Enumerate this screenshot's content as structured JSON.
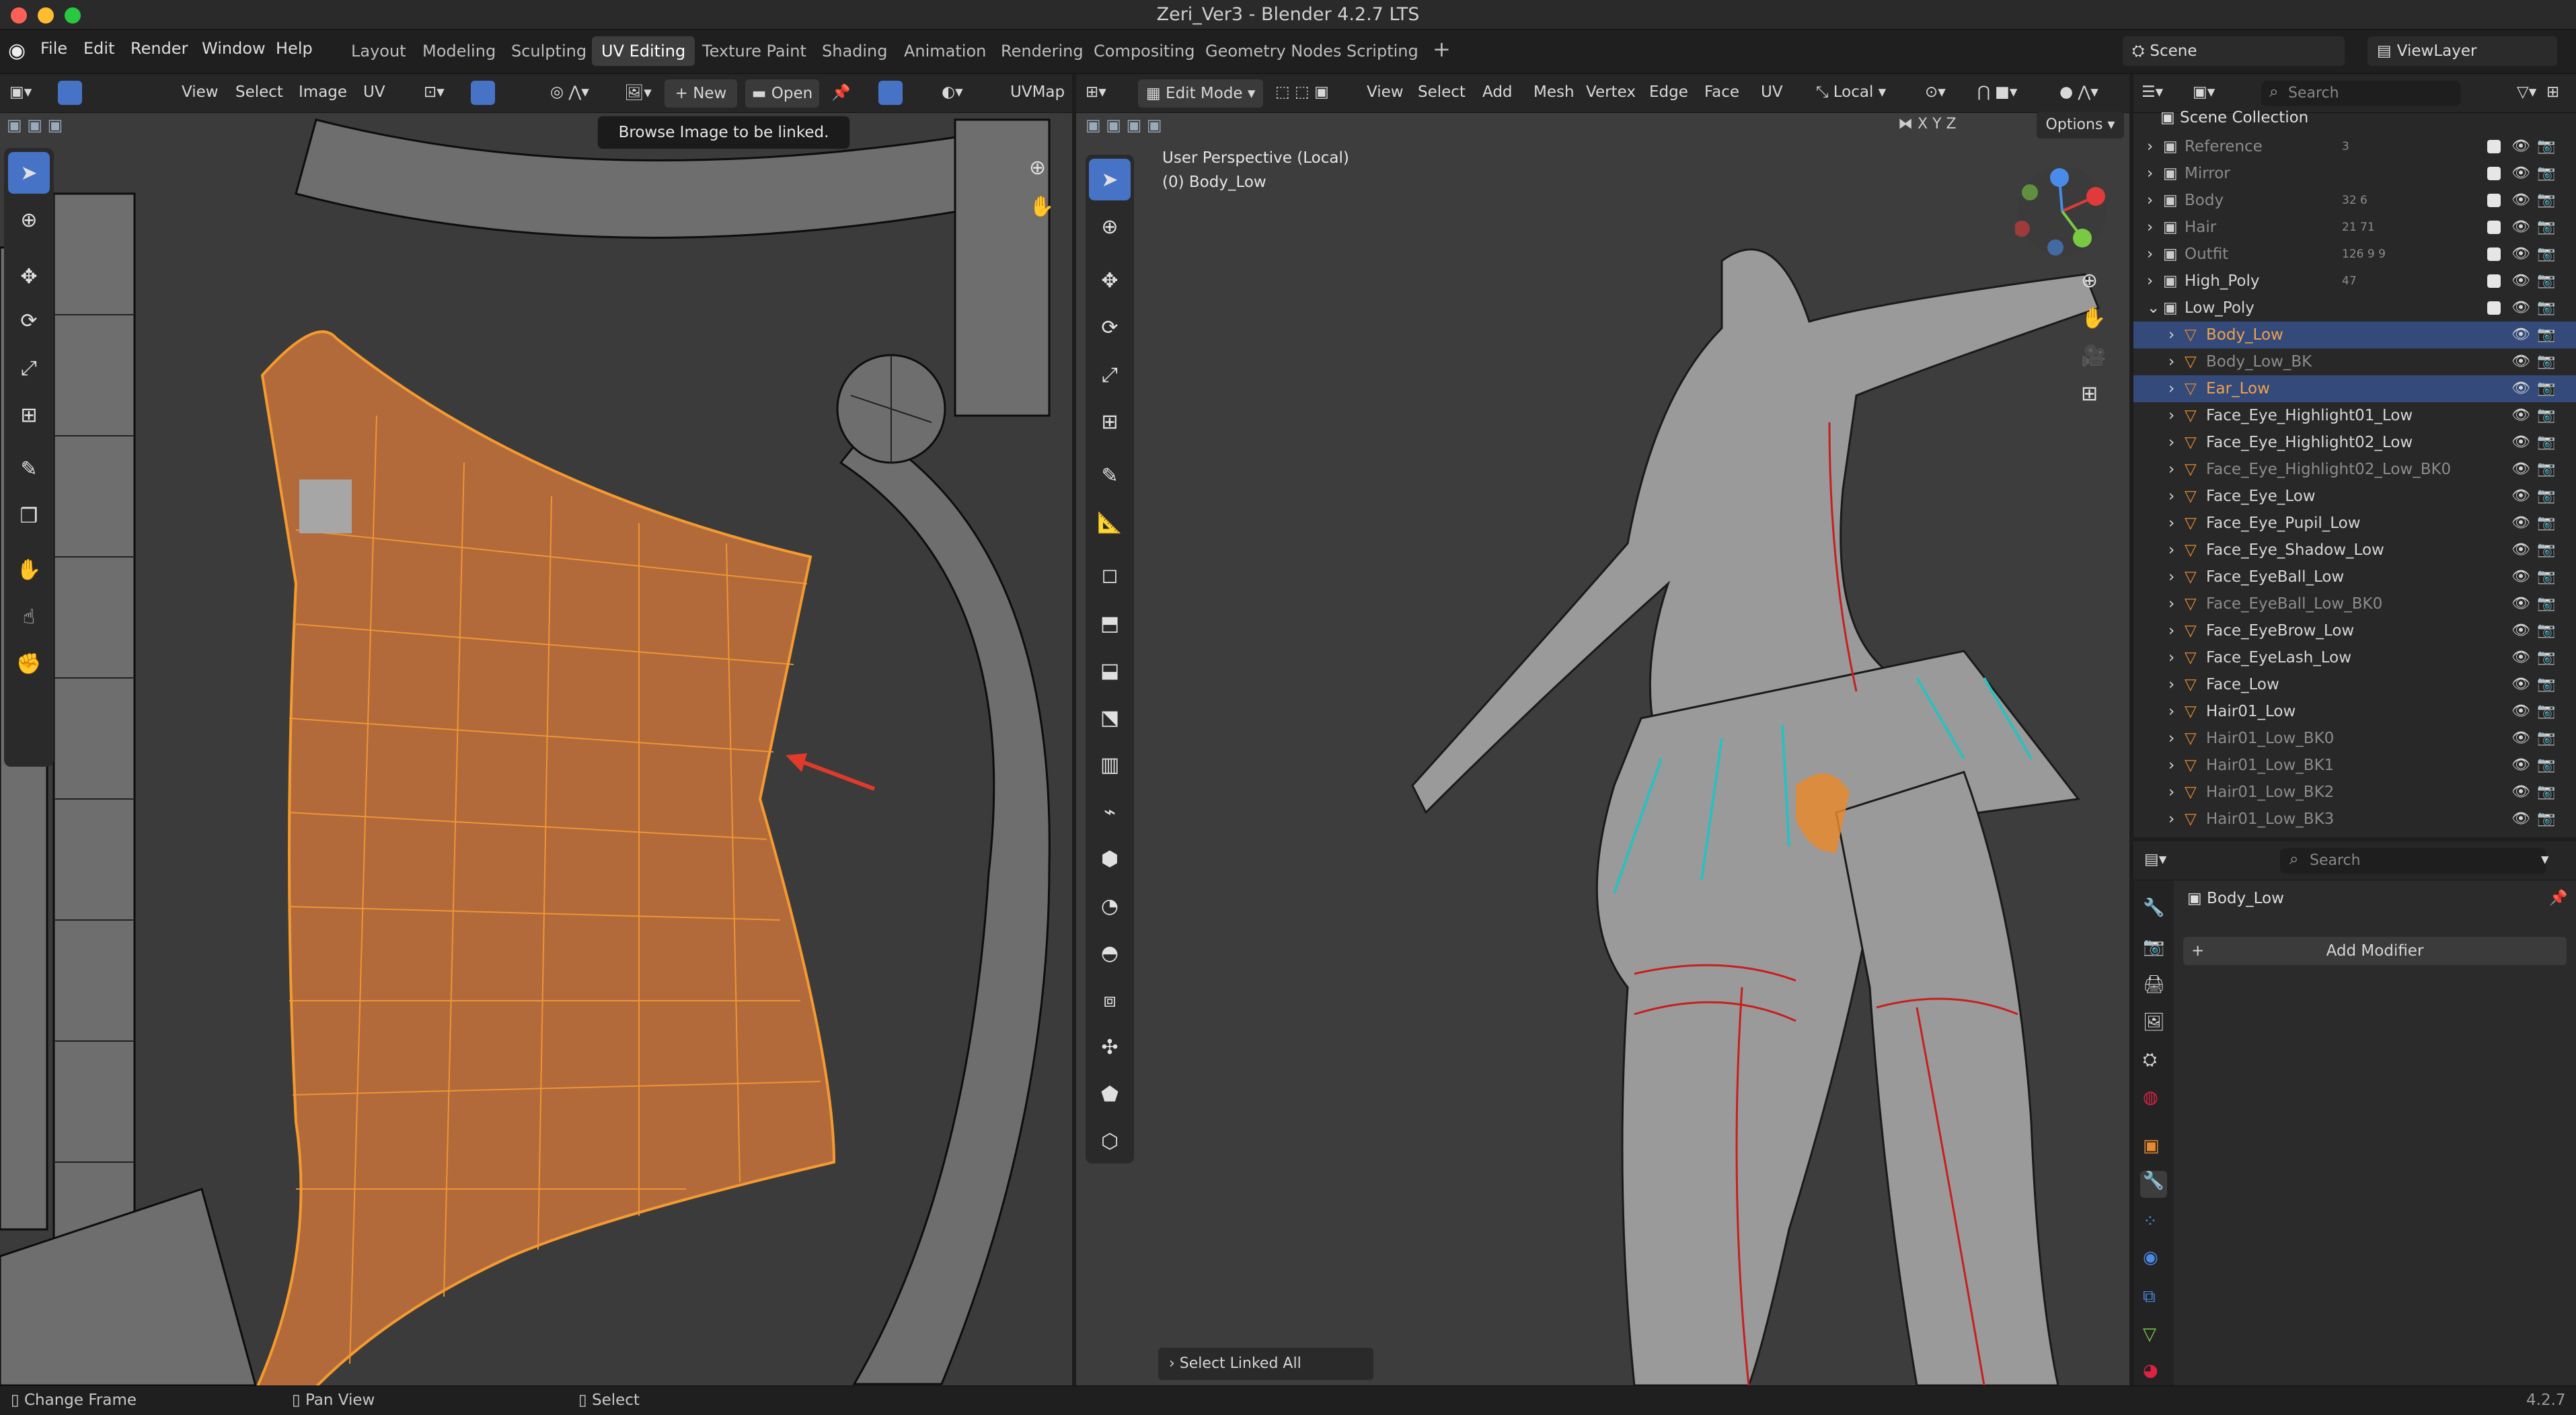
{
  "window": {
    "title": "Zeri_Ver3 - Blender 4.2.7 LTS"
  },
  "menu": [
    "File",
    "Edit",
    "Render",
    "Window",
    "Help"
  ],
  "workspaces": [
    "Layout",
    "Modeling",
    "Sculpting",
    "UV Editing",
    "Texture Paint",
    "Shading",
    "Animation",
    "Rendering",
    "Compositing",
    "Geometry Nodes",
    "Scripting"
  ],
  "active_workspace": "UV Editing",
  "scene": {
    "name": "Scene",
    "view_layer": "ViewLayer"
  },
  "uv_editor": {
    "menus": [
      "View",
      "Select",
      "Image",
      "UV"
    ],
    "new_label": "New",
    "open_label": "Open",
    "uvmap_label": "UVMap",
    "tooltip": "Browse Image to be linked."
  },
  "viewport": {
    "mode": "Edit Mode",
    "menus": [
      "View",
      "Select",
      "Add",
      "Mesh",
      "Vertex",
      "Edge",
      "Face",
      "UV"
    ],
    "orientation": "Local",
    "axes": [
      "X",
      "Y",
      "Z"
    ],
    "options_label": "Options",
    "perspective": "User Perspective (Local)",
    "object": "(0) Body_Low",
    "last_op": "Select Linked All"
  },
  "outliner": {
    "search_placeholder": "Search",
    "root": "Scene Collection",
    "rows": [
      {
        "label": "Reference",
        "badge": "3",
        "dim": true
      },
      {
        "label": "Mirror",
        "dim": true
      },
      {
        "label": "Body",
        "badge": "32 6",
        "dim": true
      },
      {
        "label": "Hair",
        "badge": "21 71",
        "dim": true
      },
      {
        "label": "Outfit",
        "badge": "126 9 9",
        "dim": true
      },
      {
        "label": "High_Poly",
        "badge": "47"
      },
      {
        "label": "Low_Poly"
      },
      {
        "label": "Body_Low",
        "selected": true,
        "highlight": true
      },
      {
        "label": "Body_Low_BK",
        "dim": true
      },
      {
        "label": "Ear_Low",
        "selected": true,
        "highlight": true
      },
      {
        "label": "Face_Eye_Highlight01_Low"
      },
      {
        "label": "Face_Eye_Highlight02_Low"
      },
      {
        "label": "Face_Eye_Highlight02_Low_BK0",
        "dim": true
      },
      {
        "label": "Face_Eye_Low"
      },
      {
        "label": "Face_Eye_Pupil_Low"
      },
      {
        "label": "Face_Eye_Shadow_Low"
      },
      {
        "label": "Face_EyeBall_Low"
      },
      {
        "label": "Face_EyeBall_Low_BK0",
        "dim": true
      },
      {
        "label": "Face_EyeBrow_Low"
      },
      {
        "label": "Face_EyeLash_Low"
      },
      {
        "label": "Face_Low"
      },
      {
        "label": "Hair01_Low"
      },
      {
        "label": "Hair01_Low_BK0",
        "dim": true
      },
      {
        "label": "Hair01_Low_BK1",
        "dim": true
      },
      {
        "label": "Hair01_Low_BK2",
        "dim": true
      },
      {
        "label": "Hair01_Low_BK3",
        "dim": true
      }
    ]
  },
  "properties": {
    "search_placeholder": "Search",
    "object": "Body_Low",
    "add_modifier": "Add Modifier"
  },
  "status": {
    "left": "Change Frame",
    "mid": "Pan View",
    "right": "Select",
    "version": "4.2.7"
  },
  "colors": {
    "accent": "#4773c7",
    "selection": "#e88a2f",
    "uv_bg": "#3b3b3b",
    "seam": "#c81e1e",
    "sharp": "#2dbfbf"
  }
}
